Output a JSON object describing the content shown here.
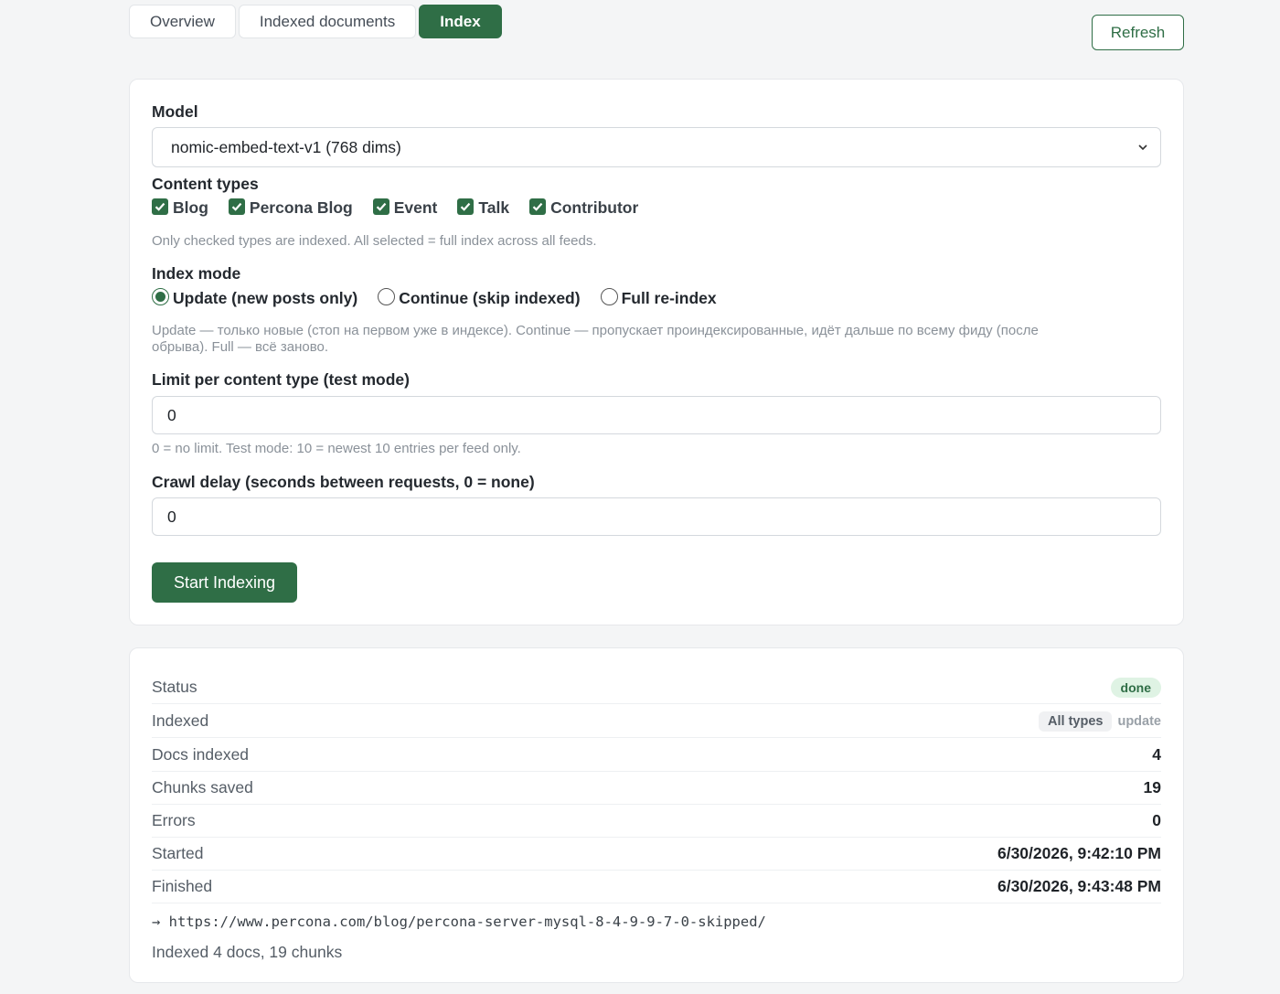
{
  "tabs": [
    {
      "label": "Overview",
      "active": false
    },
    {
      "label": "Indexed documents",
      "active": false
    },
    {
      "label": "Index",
      "active": true
    }
  ],
  "refresh_label": "Refresh",
  "form": {
    "model": {
      "label": "Model",
      "selected": "nomic-embed-text-v1 (768 dims)"
    },
    "content_types": {
      "label": "Content types",
      "options": [
        {
          "label": "Blog",
          "checked": true
        },
        {
          "label": "Percona Blog",
          "checked": true
        },
        {
          "label": "Event",
          "checked": true
        },
        {
          "label": "Talk",
          "checked": true
        },
        {
          "label": "Contributor",
          "checked": true
        }
      ],
      "help": "Only checked types are indexed. All selected = full index across all feeds."
    },
    "index_mode": {
      "label": "Index mode",
      "options": [
        {
          "label": "Update (new posts only)",
          "selected": true
        },
        {
          "label": "Continue (skip indexed)",
          "selected": false
        },
        {
          "label": "Full re-index",
          "selected": false
        }
      ],
      "help_line1": "Update — только новые (стоп на первом уже в индексе). Continue — пропускает проиндексированные, идёт дальше по всему фиду (после",
      "help_line2": "обрыва). Full — всё заново."
    },
    "limit": {
      "label": "Limit per content type (test mode)",
      "value": "0",
      "help": "0 = no limit. Test mode: 10 = newest 10 entries per feed only."
    },
    "crawl_delay": {
      "label": "Crawl delay (seconds between requests, 0 = none)",
      "value": "0"
    },
    "start_label": "Start Indexing"
  },
  "status": {
    "rows": [
      {
        "key": "Status",
        "value": "done"
      },
      {
        "key": "Indexed",
        "types_badge": "All types",
        "mode": "update"
      },
      {
        "key": "Docs indexed",
        "value": "4"
      },
      {
        "key": "Chunks saved",
        "value": "19"
      },
      {
        "key": "Errors",
        "value": "0"
      },
      {
        "key": "Started",
        "value": "6/30/2026, 9:42:10 PM"
      },
      {
        "key": "Finished",
        "value": "6/30/2026, 9:43:48 PM"
      }
    ],
    "last_url": "→ https://www.percona.com/blog/percona-server-mysql-8-4-9-9-7-0-skipped/",
    "summary": "Indexed 4 docs, 19 chunks"
  },
  "colors": {
    "accent": "#2f6e46",
    "done_badge_bg": "#dff3e4"
  }
}
